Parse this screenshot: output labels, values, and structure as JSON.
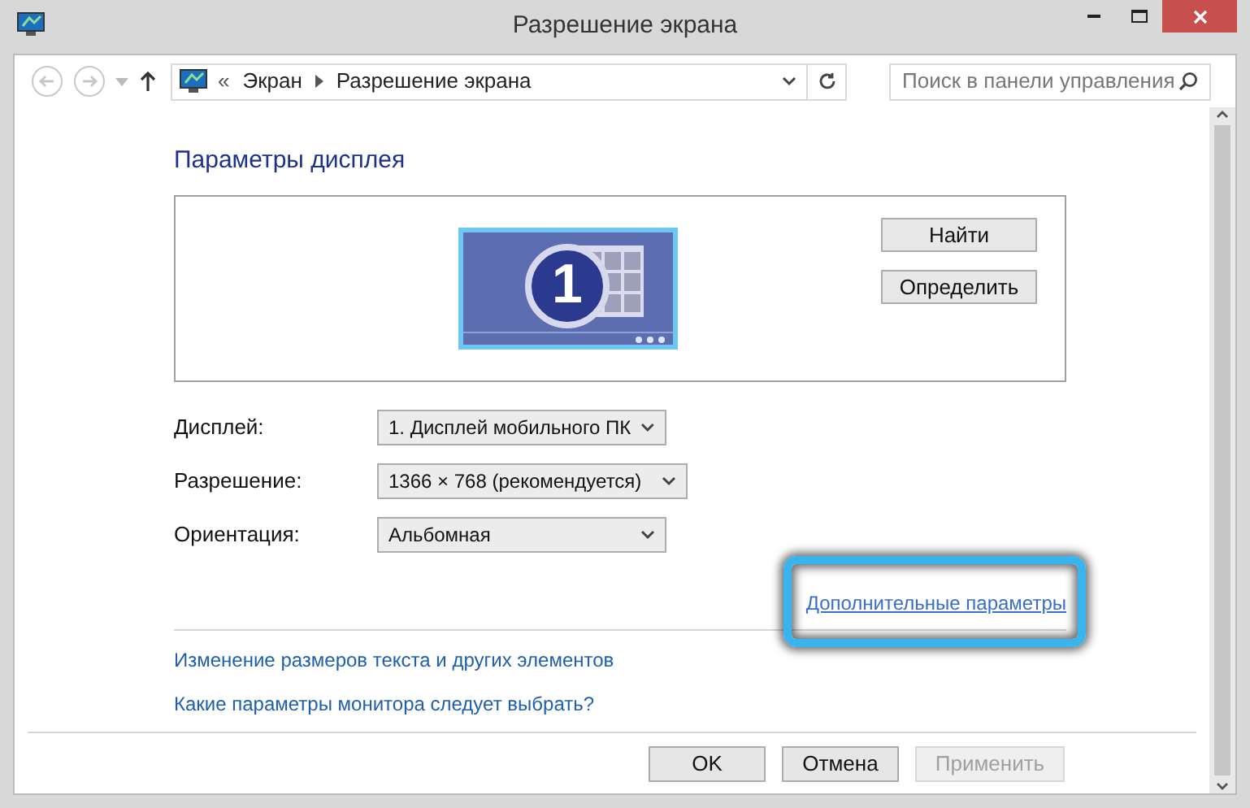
{
  "window": {
    "title": "Разрешение экрана"
  },
  "navigation": {
    "back_disabled": true,
    "forward_disabled": true,
    "breadcrumb": {
      "prefix": "«",
      "items": [
        "Экран",
        "Разрешение экрана"
      ]
    },
    "search": {
      "placeholder": "Поиск в панели управления"
    }
  },
  "heading": "Параметры дисплея",
  "monitor_area": {
    "monitor_number": "1",
    "buttons": [
      "Найти",
      "Определить"
    ]
  },
  "settings": [
    {
      "label": "Дисплей:",
      "value": "1. Дисплей мобильного ПК"
    },
    {
      "label": "Разрешение:",
      "value": "1366 × 768 (рекомендуется)"
    },
    {
      "label": "Ориентация:",
      "value": "Альбомная"
    }
  ],
  "advanced_link": {
    "text": "Дополнительные параметры",
    "highlighted": true
  },
  "links": [
    "Изменение размеров текста и других элементов",
    "Какие параметры монитора следует выбрать?"
  ],
  "buttons": [
    {
      "label": "OK",
      "disabled": false
    },
    {
      "label": "Отмена",
      "disabled": false
    },
    {
      "label": "Применить",
      "disabled": true
    }
  ]
}
